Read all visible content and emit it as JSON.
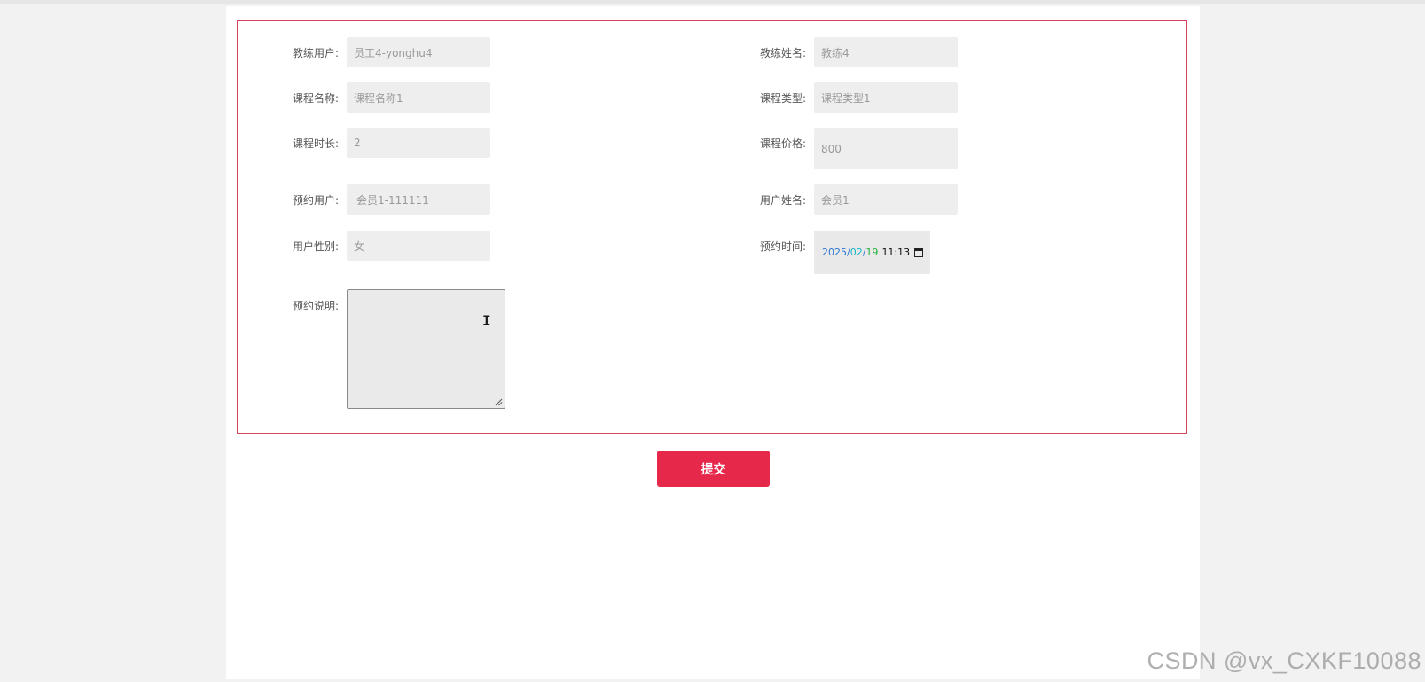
{
  "form": {
    "coach_user": {
      "label": "教练用户:",
      "value": "员工4-yonghu4"
    },
    "coach_name": {
      "label": "教练姓名:",
      "value": "教练4"
    },
    "course_name": {
      "label": "课程名称:",
      "value": "课程名称1"
    },
    "course_type": {
      "label": "课程类型:",
      "value": "课程类型1"
    },
    "course_duration": {
      "label": "课程时长:",
      "value": "2"
    },
    "course_price": {
      "label": "课程价格:",
      "value": "800"
    },
    "booking_user": {
      "label": "预约用户:",
      "value": "会员1-111111"
    },
    "user_name": {
      "label": "用户姓名:",
      "value": "会员1"
    },
    "user_gender": {
      "label": "用户性别:",
      "value": "女"
    },
    "booking_time": {
      "label": "预约时间:",
      "year": "2025",
      "sep1": "/",
      "month": "02",
      "sep2": "/",
      "day": "19",
      "time": "11:13"
    },
    "booking_note": {
      "label": "预约说明:",
      "value": ""
    }
  },
  "submit_label": "提交",
  "watermark": "CSDN @vx_CXKF10088",
  "colors": {
    "accent": "#e6284b",
    "border": "#d7465e",
    "field_bg": "#eeeeee"
  }
}
